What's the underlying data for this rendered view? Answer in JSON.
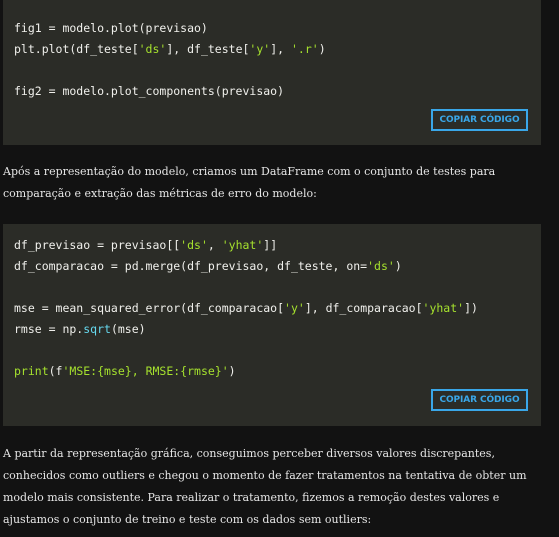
{
  "code_block_1": {
    "lines": [
      {
        "segments": [
          {
            "t": "fig1 = modelo.plot(previsao)",
            "c": "plain"
          }
        ]
      },
      {
        "segments": [
          {
            "t": "plt.plot(df_teste[",
            "c": "plain"
          },
          {
            "t": "'ds'",
            "c": "str"
          },
          {
            "t": "], df_teste[",
            "c": "plain"
          },
          {
            "t": "'y'",
            "c": "str"
          },
          {
            "t": "], ",
            "c": "plain"
          },
          {
            "t": "'.r'",
            "c": "str"
          },
          {
            "t": ")",
            "c": "plain"
          }
        ]
      },
      {
        "segments": []
      },
      {
        "segments": [
          {
            "t": "fig2 = modelo.plot_components(previsao)",
            "c": "plain"
          }
        ]
      }
    ],
    "button_label": "COPIAR CÓDIGO"
  },
  "paragraph_1": "Após a representação do modelo, criamos um DataFrame com o conjunto de testes para comparação e extração das métricas de erro do modelo:",
  "code_block_2": {
    "lines": [
      {
        "segments": [
          {
            "t": "df_previsao = previsao[[",
            "c": "plain"
          },
          {
            "t": "'ds'",
            "c": "str"
          },
          {
            "t": ", ",
            "c": "plain"
          },
          {
            "t": "'yhat'",
            "c": "str"
          },
          {
            "t": "]]",
            "c": "plain"
          }
        ]
      },
      {
        "segments": [
          {
            "t": "df_comparacao = pd.merge(df_previsao, df_teste, on=",
            "c": "plain"
          },
          {
            "t": "'ds'",
            "c": "str"
          },
          {
            "t": ")",
            "c": "plain"
          }
        ]
      },
      {
        "segments": []
      },
      {
        "segments": [
          {
            "t": "mse = mean_squared_error(df_comparacao[",
            "c": "plain"
          },
          {
            "t": "'y'",
            "c": "str"
          },
          {
            "t": "], df_comparacao[",
            "c": "plain"
          },
          {
            "t": "'yhat'",
            "c": "str"
          },
          {
            "t": "])",
            "c": "plain"
          }
        ]
      },
      {
        "segments": [
          {
            "t": "rmse = np.",
            "c": "plain"
          },
          {
            "t": "sqrt",
            "c": "fn"
          },
          {
            "t": "(mse)",
            "c": "plain"
          }
        ]
      },
      {
        "segments": []
      },
      {
        "segments": [
          {
            "t": "print",
            "c": "str"
          },
          {
            "t": "(f",
            "c": "plain"
          },
          {
            "t": "'MSE:{mse}, RMSE:{rmse}'",
            "c": "str"
          },
          {
            "t": ")",
            "c": "plain"
          }
        ]
      }
    ],
    "button_label": "COPIAR CÓDIGO"
  },
  "paragraph_2": "A partir da representação gráfica, conseguimos perceber diversos valores discrepantes, conhecidos como outliers e chegou o momento de fazer tratamentos na tentativa de obter um modelo mais consistente. Para realizar o tratamento, fizemos a remoção destes valores e ajustamos o conjunto de treino e teste com os dados sem outliers:",
  "colors": {
    "page_background": "#121212",
    "code_background": "#2b2c27",
    "code_text": "#f0f0ec",
    "string_token": "#a6e22e",
    "function_token": "#66d9ef",
    "button_accent": "#3aa7e8",
    "body_text": "#e6e6e6"
  }
}
